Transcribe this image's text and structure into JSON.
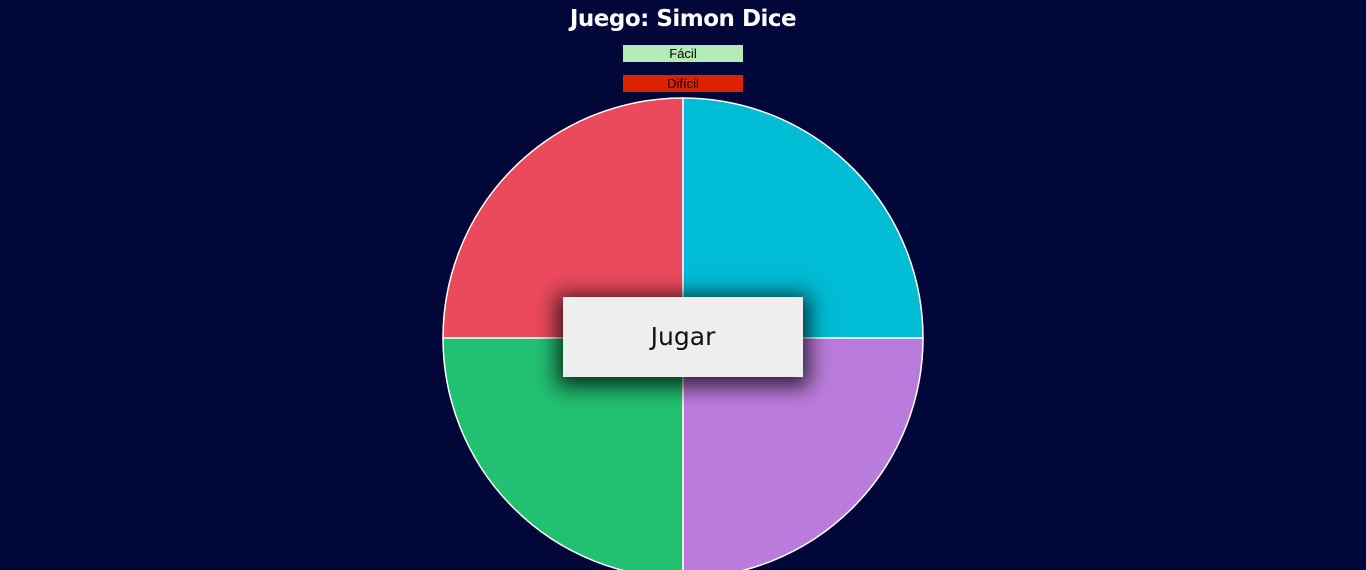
{
  "header": {
    "title": "Juego: Simon Dice"
  },
  "levels": {
    "easy_label": "Fácil",
    "hard_label": "Difícil",
    "easy_color": "#b2ebb4",
    "hard_color": "#dd2200"
  },
  "board": {
    "quadrants": [
      {
        "name": "top-left",
        "color": "#ea4a5c"
      },
      {
        "name": "top-right",
        "color": "#00bcd4"
      },
      {
        "name": "bottom-left",
        "color": "#22c172"
      },
      {
        "name": "bottom-right",
        "color": "#ba7cdc"
      }
    ]
  },
  "play": {
    "label": "Jugar"
  },
  "colors": {
    "background": "#000638",
    "play_button": "#eeeeee"
  }
}
